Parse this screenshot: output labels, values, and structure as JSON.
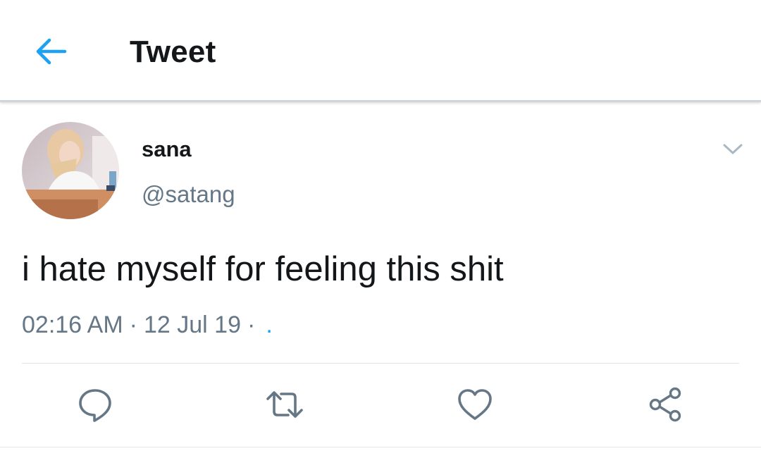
{
  "header": {
    "title": "Tweet",
    "back_icon": "arrow-left-icon",
    "accent": "#1da1f2"
  },
  "tweet": {
    "display_name": "sana",
    "handle": "@satang",
    "text": "i hate myself for feeling this shit",
    "time": "02:16 AM",
    "separator": "·",
    "date": "12 Jul 19",
    "source_dot": "."
  },
  "actions": [
    {
      "name": "reply",
      "icon": "reply-icon"
    },
    {
      "name": "retweet",
      "icon": "retweet-icon"
    },
    {
      "name": "like",
      "icon": "heart-icon"
    },
    {
      "name": "share",
      "icon": "share-icon"
    }
  ],
  "colors": {
    "text": "#14171a",
    "secondary": "#657786",
    "accent": "#1da1f2",
    "divider": "#dfe3e7"
  }
}
